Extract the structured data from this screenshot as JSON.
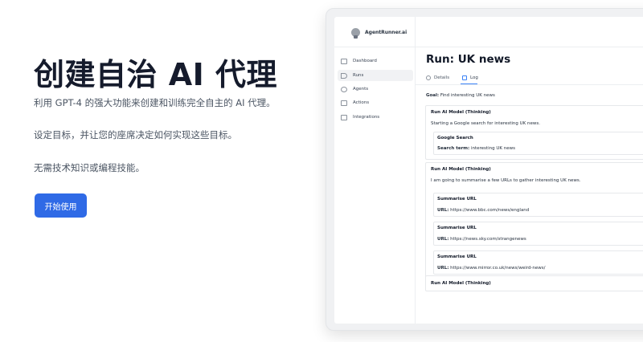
{
  "hero": {
    "title": "创建自治 AI 代理",
    "line1": "利用 GPT-4 的强大功能来创建和训练完全自主的 AI 代理。",
    "line2": "设定目标，并让您的座席决定如何实现这些目标。",
    "line3": "无需技术知识或编程技能。",
    "cta_label": "开始使用"
  },
  "app": {
    "brand": "AgentRunner.ai",
    "nav": [
      {
        "label": "Dashboard",
        "icon": "dashboard-icon"
      },
      {
        "label": "Runs",
        "icon": "play-icon",
        "active": true
      },
      {
        "label": "Agents",
        "icon": "agent-icon"
      },
      {
        "label": "Actions",
        "icon": "actions-icon"
      },
      {
        "label": "Integrations",
        "icon": "integrations-icon"
      }
    ],
    "run_title": "Run: UK news",
    "tabs": [
      {
        "label": "Details",
        "icon": "info-icon"
      },
      {
        "label": "Log",
        "icon": "log-icon",
        "active": true
      }
    ],
    "goal_label": "Goal:",
    "goal_text": "Find interesting UK news",
    "log": [
      {
        "title": "Run AI Model (Thinking)",
        "text": "Starting a Google search for interesting UK news."
      },
      {
        "title": "Google Search",
        "label": "Search term:",
        "value": "interesting UK news"
      },
      {
        "title": "Run AI Model (Thinking)",
        "text": "I am going to summarise a few URLs to gather interesting UK news."
      },
      {
        "title": "Summarise URL",
        "label": "URL:",
        "value": "https://www.bbc.com/news/england"
      },
      {
        "title": "Summarise URL",
        "label": "URL:",
        "value": "https://news.sky.com/strangenews"
      },
      {
        "title": "Summarise URL",
        "label": "URL:",
        "value": "https://www.mirror.co.uk/news/weird-news/"
      },
      {
        "title": "Run AI Model (Thinking)"
      }
    ]
  }
}
